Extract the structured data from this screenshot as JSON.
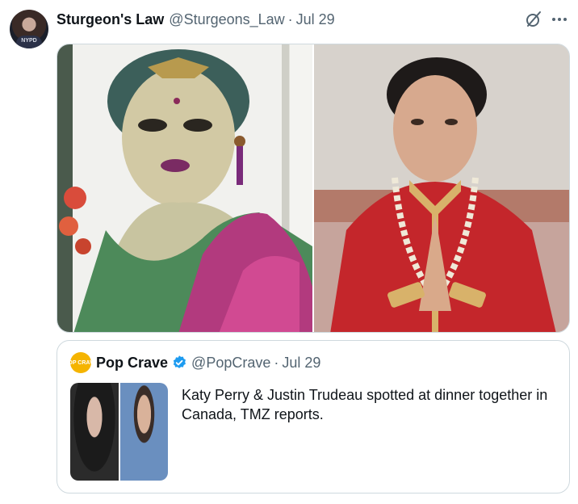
{
  "post": {
    "author_name": "Sturgeon's Law",
    "author_handle": "@Sturgeons_Law",
    "separator": "·",
    "date": "Jul 29",
    "avatar_text": "NYPD"
  },
  "quoted_post": {
    "author_name": "Pop Crave",
    "logo_text": "POP CRAVE",
    "author_handle": "@PopCrave",
    "separator": "·",
    "date": "Jul 29",
    "verified": true,
    "text": "Katy Perry & Justin Trudeau spotted at dinner together in Canada, TMZ reports."
  },
  "icons": {
    "grok": "grok-icon",
    "more": "more-icon",
    "verified": "verified-badge-icon"
  },
  "colors": {
    "secondary_text": "#536471",
    "border": "#cfd9de",
    "verified_blue": "#1d9bf0",
    "pop_crave_yellow": "#f5b400"
  }
}
